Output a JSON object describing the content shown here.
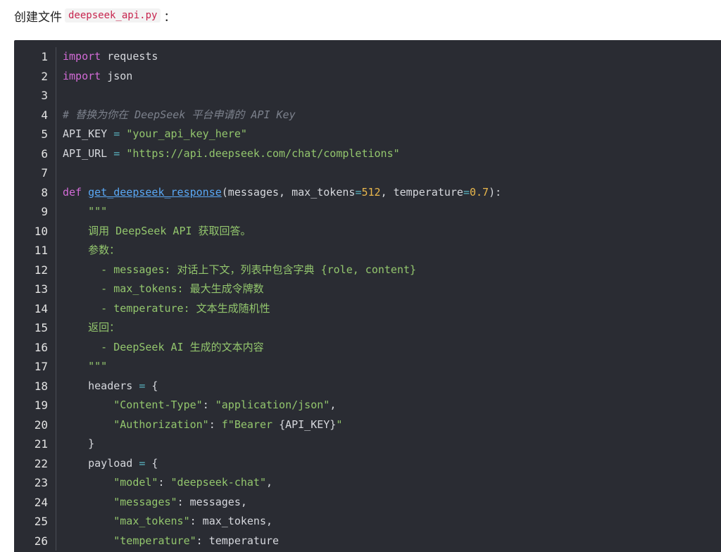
{
  "intro": {
    "prefix": "创建文件",
    "filename": "deepseek_api.py",
    "suffix": "："
  },
  "code_lines": [
    {
      "n": "1",
      "tokens": [
        [
          "kw",
          "import"
        ],
        [
          "id",
          " requests"
        ]
      ]
    },
    {
      "n": "2",
      "tokens": [
        [
          "kw",
          "import"
        ],
        [
          "id",
          " json"
        ]
      ]
    },
    {
      "n": "3",
      "tokens": []
    },
    {
      "n": "4",
      "tokens": [
        [
          "cm",
          "# 替换为你在 DeepSeek 平台申请的 API Key"
        ]
      ]
    },
    {
      "n": "5",
      "tokens": [
        [
          "id",
          "API_KEY "
        ],
        [
          "op",
          "="
        ],
        [
          "id",
          " "
        ],
        [
          "str",
          "\"your_api_key_here\""
        ]
      ]
    },
    {
      "n": "6",
      "tokens": [
        [
          "id",
          "API_URL "
        ],
        [
          "op",
          "="
        ],
        [
          "id",
          " "
        ],
        [
          "str",
          "\"https://api.deepseek.com/chat/completions\""
        ]
      ]
    },
    {
      "n": "7",
      "tokens": []
    },
    {
      "n": "8",
      "tokens": [
        [
          "kw",
          "def"
        ],
        [
          "id",
          " "
        ],
        [
          "fn",
          "get_deepseek_response"
        ],
        [
          "id",
          "(messages, max_tokens"
        ],
        [
          "op",
          "="
        ],
        [
          "num",
          "512"
        ],
        [
          "id",
          ", temperature"
        ],
        [
          "op",
          "="
        ],
        [
          "num",
          "0.7"
        ],
        [
          "id",
          "):"
        ]
      ]
    },
    {
      "n": "9",
      "tokens": [
        [
          "str",
          "    \"\"\""
        ]
      ]
    },
    {
      "n": "10",
      "tokens": [
        [
          "str",
          "    调用 DeepSeek API 获取回答。"
        ]
      ]
    },
    {
      "n": "11",
      "tokens": [
        [
          "str",
          "    参数："
        ]
      ]
    },
    {
      "n": "12",
      "tokens": [
        [
          "str",
          "      - messages: 对话上下文，列表中包含字典 {role, content}"
        ]
      ]
    },
    {
      "n": "13",
      "tokens": [
        [
          "str",
          "      - max_tokens: 最大生成令牌数"
        ]
      ]
    },
    {
      "n": "14",
      "tokens": [
        [
          "str",
          "      - temperature: 文本生成随机性"
        ]
      ]
    },
    {
      "n": "15",
      "tokens": [
        [
          "str",
          "    返回："
        ]
      ]
    },
    {
      "n": "16",
      "tokens": [
        [
          "str",
          "      - DeepSeek AI 生成的文本内容"
        ]
      ]
    },
    {
      "n": "17",
      "tokens": [
        [
          "str",
          "    \"\"\""
        ]
      ]
    },
    {
      "n": "18",
      "tokens": [
        [
          "id",
          "    headers "
        ],
        [
          "op",
          "="
        ],
        [
          "id",
          " {"
        ]
      ]
    },
    {
      "n": "19",
      "tokens": [
        [
          "id",
          "        "
        ],
        [
          "str",
          "\"Content-Type\""
        ],
        [
          "id",
          ": "
        ],
        [
          "str",
          "\"application/json\""
        ],
        [
          "id",
          ","
        ]
      ]
    },
    {
      "n": "20",
      "tokens": [
        [
          "id",
          "        "
        ],
        [
          "str",
          "\"Authorization\""
        ],
        [
          "id",
          ": "
        ],
        [
          "str",
          "f\"Bearer "
        ],
        [
          "id",
          "{API_KEY}"
        ],
        [
          "str",
          "\""
        ]
      ]
    },
    {
      "n": "21",
      "tokens": [
        [
          "id",
          "    }"
        ]
      ]
    },
    {
      "n": "22",
      "tokens": [
        [
          "id",
          "    payload "
        ],
        [
          "op",
          "="
        ],
        [
          "id",
          " {"
        ]
      ]
    },
    {
      "n": "23",
      "tokens": [
        [
          "id",
          "        "
        ],
        [
          "str",
          "\"model\""
        ],
        [
          "id",
          ": "
        ],
        [
          "str",
          "\"deepseek-chat\""
        ],
        [
          "id",
          ","
        ]
      ]
    },
    {
      "n": "24",
      "tokens": [
        [
          "id",
          "        "
        ],
        [
          "str",
          "\"messages\""
        ],
        [
          "id",
          ": messages,"
        ]
      ]
    },
    {
      "n": "25",
      "tokens": [
        [
          "id",
          "        "
        ],
        [
          "str",
          "\"max_tokens\""
        ],
        [
          "id",
          ": max_tokens,"
        ]
      ]
    },
    {
      "n": "26",
      "tokens": [
        [
          "id",
          "        "
        ],
        [
          "str",
          "\"temperature\""
        ],
        [
          "id",
          ": temperature"
        ]
      ]
    }
  ]
}
